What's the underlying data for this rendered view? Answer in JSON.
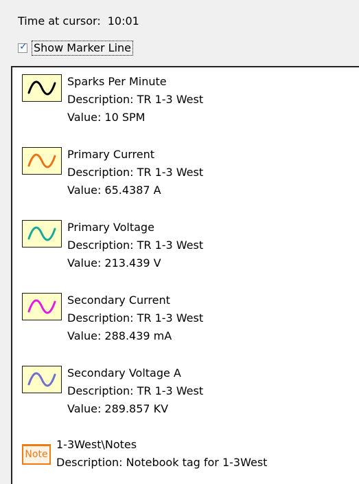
{
  "header": {
    "time_label": "Time at cursor:",
    "time_value": "10:01",
    "show_marker_label": "Show Marker Line",
    "show_marker_checked": true
  },
  "items": [
    {
      "name": "Sparks Per Minute",
      "description": "Description: TR 1-3 West",
      "value": "Value: 10 SPM",
      "color": "#000000",
      "icon": "sine-wave-icon"
    },
    {
      "name": "Primary Current",
      "description": "Description: TR 1-3 West",
      "value": "Value: 65.4387 A",
      "color": "#e8741a",
      "icon": "sine-wave-icon"
    },
    {
      "name": "Primary Voltage",
      "description": "Description: TR 1-3 West",
      "value": "Value: 213.439 V",
      "color": "#1aa89a",
      "icon": "sine-wave-icon"
    },
    {
      "name": "Secondary Current",
      "description": "Description: TR 1-3 West",
      "value": "Value: 288.439 mA",
      "color": "#e01ce0",
      "icon": "sine-wave-icon"
    },
    {
      "name": "Secondary Voltage A",
      "description": "Description: TR 1-3 West",
      "value": "Value: 289.857 KV",
      "color": "#6f6fd0",
      "icon": "sine-wave-icon"
    }
  ],
  "note": {
    "icon_label": "Note",
    "name": "1-3West\\Notes",
    "description": "Description: Notebook tag for 1-3West",
    "color": "#f07a14",
    "icon": "note-icon"
  }
}
